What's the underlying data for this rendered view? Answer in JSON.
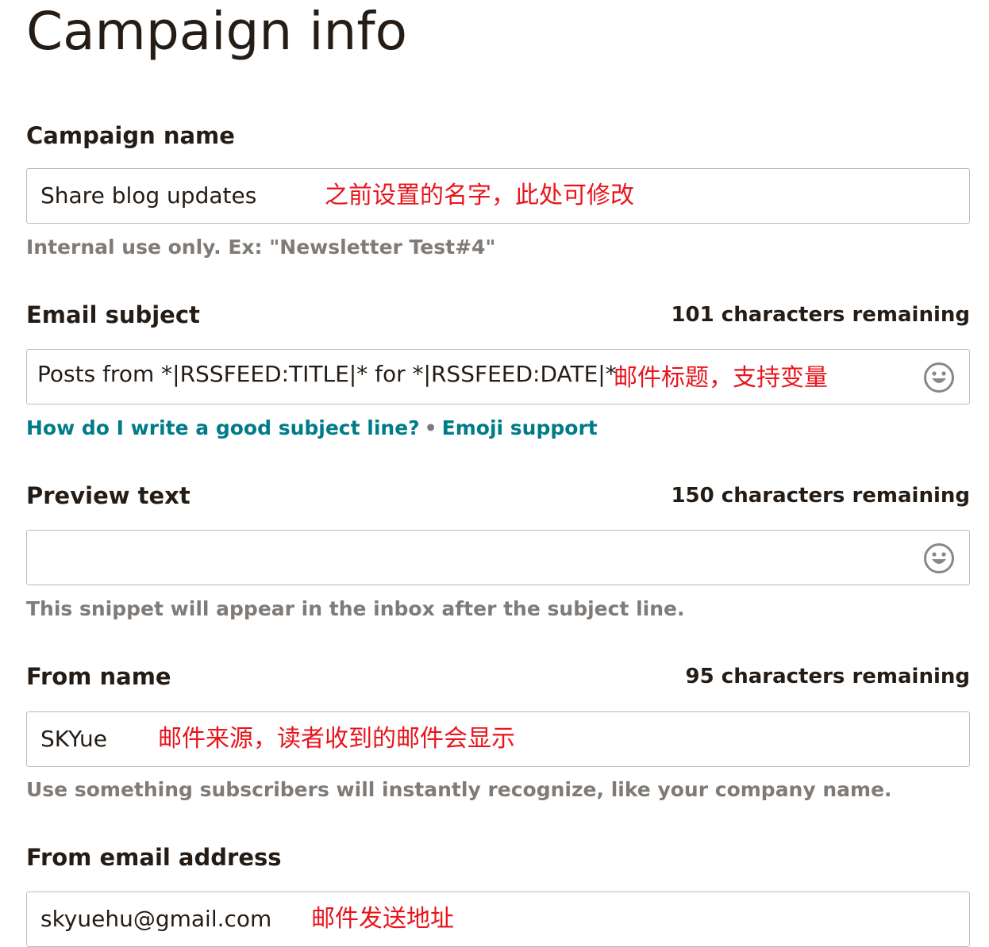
{
  "page": {
    "title": "Campaign info"
  },
  "campaign_name": {
    "label": "Campaign name",
    "value": "Share blog updates",
    "annotation": "之前设置的名字，此处可修改",
    "helper": "Internal use only. Ex: \"Newsletter Test#4\""
  },
  "email_subject": {
    "label": "Email subject",
    "remaining": "101 characters remaining",
    "value": "Posts from *|RSSFEED:TITLE|* for *|RSSFEED:DATE|*",
    "annotation": "邮件标题，支持变量",
    "icon": "emoji-smile-icon",
    "link_subject": "How do I write a good subject line?",
    "link_separator": "•",
    "link_emoji": "Emoji support"
  },
  "preview_text": {
    "label": "Preview text",
    "remaining": "150 characters remaining",
    "value": "",
    "icon": "emoji-smile-icon",
    "helper": "This snippet will appear in the inbox after the subject line."
  },
  "from_name": {
    "label": "From name",
    "remaining": "95 characters remaining",
    "value": "SKYue",
    "annotation": "邮件来源，读者收到的邮件会显示",
    "helper": "Use something subscribers will instantly recognize, like your company name."
  },
  "from_email": {
    "label": "From email address",
    "value": "skyuehu@gmail.com",
    "annotation": "邮件发送地址"
  },
  "colors": {
    "text": "#241c15",
    "helper": "#807b77",
    "link": "#007c89",
    "annotation": "#e8151c",
    "border": "#bdbbb9"
  }
}
